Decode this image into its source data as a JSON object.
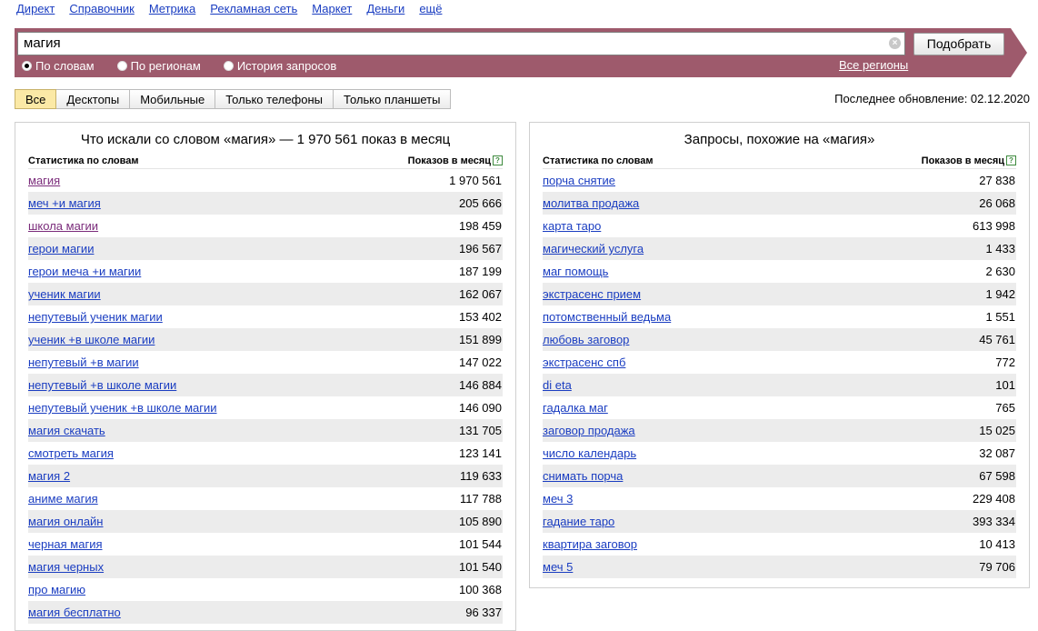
{
  "topnav": [
    "Директ",
    "Справочник",
    "Метрика",
    "Рекламная сеть",
    "Маркет",
    "Деньги",
    "ещё"
  ],
  "search": {
    "value": "магия",
    "button": "Подобрать",
    "clear_icon": "clear-icon",
    "radios": [
      {
        "label": "По словам",
        "checked": true
      },
      {
        "label": "По регионам",
        "checked": false
      },
      {
        "label": "История запросов",
        "checked": false
      }
    ],
    "regions_link": "Все регионы",
    "band_color": "#9e5a6c"
  },
  "tabs": [
    "Все",
    "Десктопы",
    "Мобильные",
    "Только телефоны",
    "Только планшеты"
  ],
  "active_tab": "Все",
  "updated": "Последнее обновление: 02.12.2020",
  "left_panel": {
    "title": "Что искали со словом «магия» — 1 970 561 показ в месяц",
    "col_keyword": "Статистика по словам",
    "col_count": "Показов в месяц",
    "rows": [
      {
        "kw": "магия",
        "count": "1 970 561",
        "visited": true
      },
      {
        "kw": "меч +и магия",
        "count": "205 666"
      },
      {
        "kw": "школа магии",
        "count": "198 459",
        "visited": true
      },
      {
        "kw": "герои магии",
        "count": "196 567"
      },
      {
        "kw": "герои меча +и магии",
        "count": "187 199"
      },
      {
        "kw": "ученик магии",
        "count": "162 067"
      },
      {
        "kw": "непутевый ученик магии",
        "count": "153 402"
      },
      {
        "kw": "ученик +в школе магии",
        "count": "151 899"
      },
      {
        "kw": "непутевый +в магии",
        "count": "147 022"
      },
      {
        "kw": "непутевый +в школе магии",
        "count": "146 884"
      },
      {
        "kw": "непутевый ученик +в школе магии",
        "count": "146 090"
      },
      {
        "kw": "магия скачать",
        "count": "131 705"
      },
      {
        "kw": "смотреть магия",
        "count": "123 141"
      },
      {
        "kw": "магия 2",
        "count": "119 633"
      },
      {
        "kw": "аниме магия",
        "count": "117 788"
      },
      {
        "kw": "магия онлайн",
        "count": "105 890"
      },
      {
        "kw": "черная магия",
        "count": "101 544"
      },
      {
        "kw": "магия черных",
        "count": "101 540"
      },
      {
        "kw": "про магию",
        "count": "100 368"
      },
      {
        "kw": "магия бесплатно",
        "count": "96 337"
      }
    ]
  },
  "right_panel": {
    "title": "Запросы, похожие на «магия»",
    "col_keyword": "Статистика по словам",
    "col_count": "Показов в месяц",
    "rows": [
      {
        "kw": "порча снятие",
        "count": "27 838"
      },
      {
        "kw": "молитва продажа",
        "count": "26 068"
      },
      {
        "kw": "карта таро",
        "count": "613 998"
      },
      {
        "kw": "магический услуга",
        "count": "1 433"
      },
      {
        "kw": "маг помощь",
        "count": "2 630"
      },
      {
        "kw": "экстрасенс прием",
        "count": "1 942"
      },
      {
        "kw": "потомственный ведьма",
        "count": "1 551"
      },
      {
        "kw": "любовь заговор",
        "count": "45 761"
      },
      {
        "kw": "экстрасенс спб",
        "count": "772"
      },
      {
        "kw": "di eta",
        "count": "101"
      },
      {
        "kw": "гадалка маг",
        "count": "765"
      },
      {
        "kw": "заговор продажа",
        "count": "15 025"
      },
      {
        "kw": "число календарь",
        "count": "32 087"
      },
      {
        "kw": "снимать порча",
        "count": "67 598"
      },
      {
        "kw": "меч 3",
        "count": "229 408"
      },
      {
        "kw": "гадание таро",
        "count": "393 334"
      },
      {
        "kw": "квартира заговор",
        "count": "10 413"
      },
      {
        "kw": "меч 5",
        "count": "79 706"
      }
    ]
  }
}
